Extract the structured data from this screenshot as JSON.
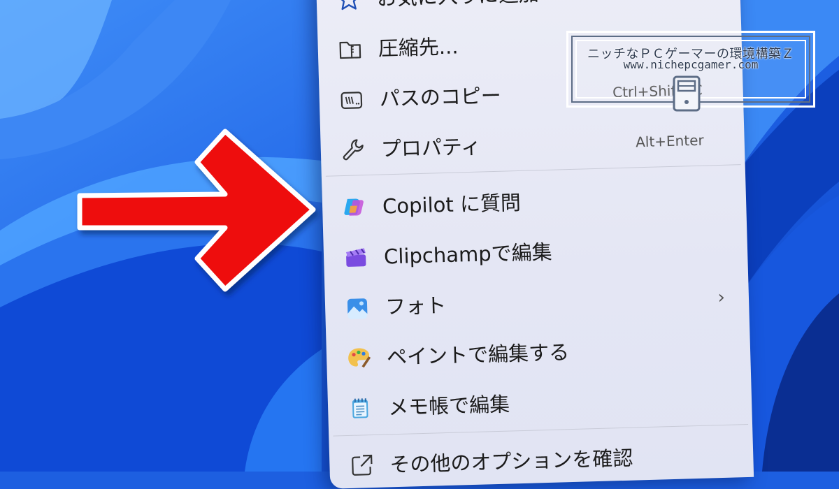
{
  "menu": {
    "items": [
      {
        "label": "お気に入りに追加",
        "shortcut": "",
        "icon": "star-icon"
      },
      {
        "label": "圧縮先...",
        "shortcut": "",
        "icon": "zip-folder-icon"
      },
      {
        "label": "パスのコピー",
        "shortcut": "Ctrl+Shift+C",
        "icon": "copy-path-icon"
      },
      {
        "label": "プロパティ",
        "shortcut": "Alt+Enter",
        "icon": "wrench-icon"
      },
      {
        "label": "Copilot に質問",
        "shortcut": "",
        "icon": "copilot-icon"
      },
      {
        "label": "Clipchampで編集",
        "shortcut": "",
        "icon": "clipchamp-icon"
      },
      {
        "label": "フォト",
        "shortcut": "",
        "icon": "photos-icon",
        "submenu": true
      },
      {
        "label": "ペイントで編集する",
        "shortcut": "",
        "icon": "paint-icon"
      },
      {
        "label": "メモ帳で編集",
        "shortcut": "",
        "icon": "notepad-icon"
      },
      {
        "label": "その他のオプションを確認",
        "shortcut": "",
        "icon": "open-external-icon"
      }
    ],
    "submenu_glyph": "›"
  },
  "watermark": {
    "title": "ニッチなＰＣゲーマーの環境構築Ｚ",
    "url": "www.nichepcgamer.com"
  },
  "colors": {
    "arrow_fill": "#ee1111",
    "wallpaper": "#1d5fe0",
    "menu_bg": "#e8eaf6"
  }
}
